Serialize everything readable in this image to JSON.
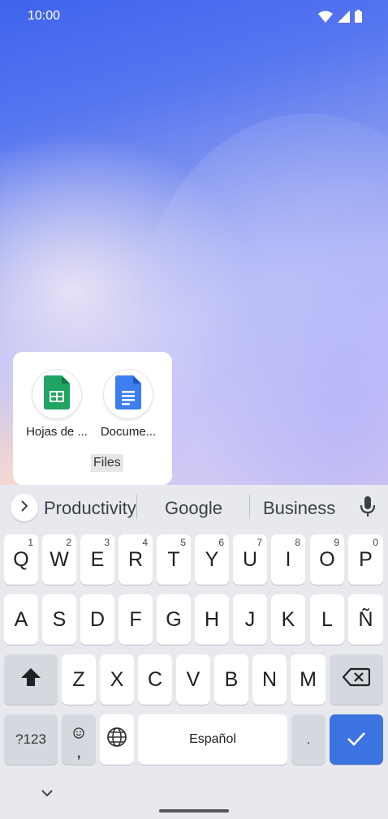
{
  "status_bar": {
    "time": "10:00",
    "icons": [
      "wifi-icon",
      "cell-signal-icon",
      "battery-icon"
    ]
  },
  "folder": {
    "name": "Files",
    "apps": [
      {
        "label": "Hojas de ...",
        "icon": "google-sheets-icon"
      },
      {
        "label": "Docume...",
        "icon": "google-docs-icon"
      }
    ]
  },
  "keyboard": {
    "suggestions": [
      "Productivity",
      "Google",
      "Business"
    ],
    "row1": [
      {
        "key": "Q",
        "hint": "1"
      },
      {
        "key": "W",
        "hint": "2"
      },
      {
        "key": "E",
        "hint": "3"
      },
      {
        "key": "R",
        "hint": "4"
      },
      {
        "key": "T",
        "hint": "5"
      },
      {
        "key": "Y",
        "hint": "6"
      },
      {
        "key": "U",
        "hint": "7"
      },
      {
        "key": "I",
        "hint": "8"
      },
      {
        "key": "O",
        "hint": "9"
      },
      {
        "key": "P",
        "hint": "0"
      }
    ],
    "row2": [
      "A",
      "S",
      "D",
      "F",
      "G",
      "H",
      "J",
      "K",
      "L",
      "Ñ"
    ],
    "row3": [
      "Z",
      "X",
      "C",
      "V",
      "B",
      "N",
      "M"
    ],
    "symbols_label": "?123",
    "comma": ",",
    "space_label": "Español",
    "period": ".",
    "accent_color": "#3b74e0"
  }
}
